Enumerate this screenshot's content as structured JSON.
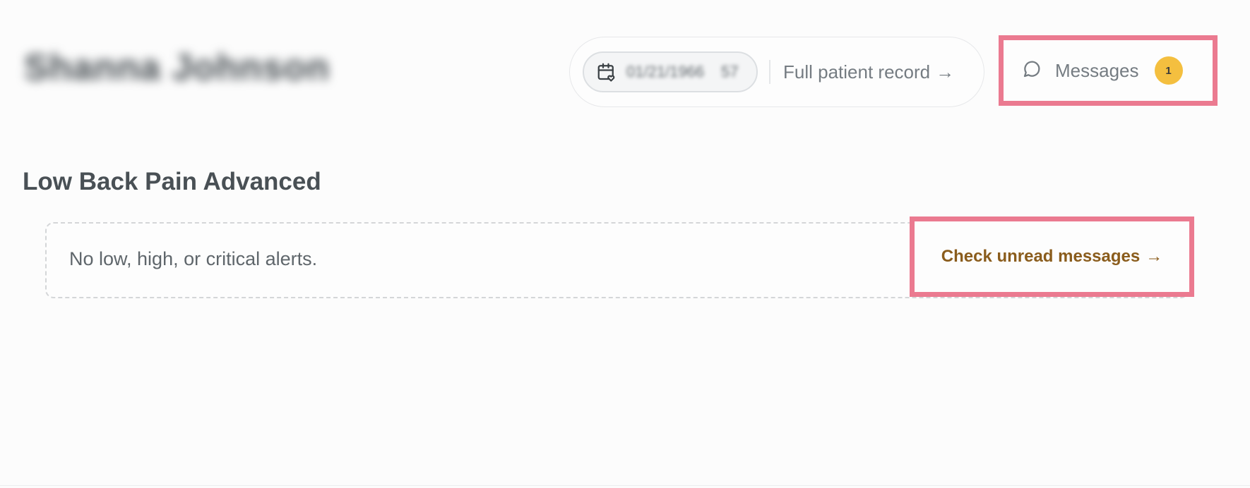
{
  "patient": {
    "name": "Shanna Johnson",
    "dob": "01/21/1966",
    "age": "57"
  },
  "header": {
    "full_record_label": "Full patient record",
    "full_record_arrow": "→",
    "messages_label": "Messages",
    "messages_count": "1"
  },
  "section": {
    "title": "Low Back Pain Advanced",
    "alerts_text": "No low, high, or critical alerts.",
    "check_messages_label": "Check unread messages",
    "check_messages_arrow": "→"
  },
  "icons": {
    "dob": "calendar-heart-icon",
    "messages": "chat-bubble-icon"
  },
  "colors": {
    "highlight": "#eb7a90",
    "badge": "#f4bf3f",
    "link_accent": "#8a5c1c"
  }
}
